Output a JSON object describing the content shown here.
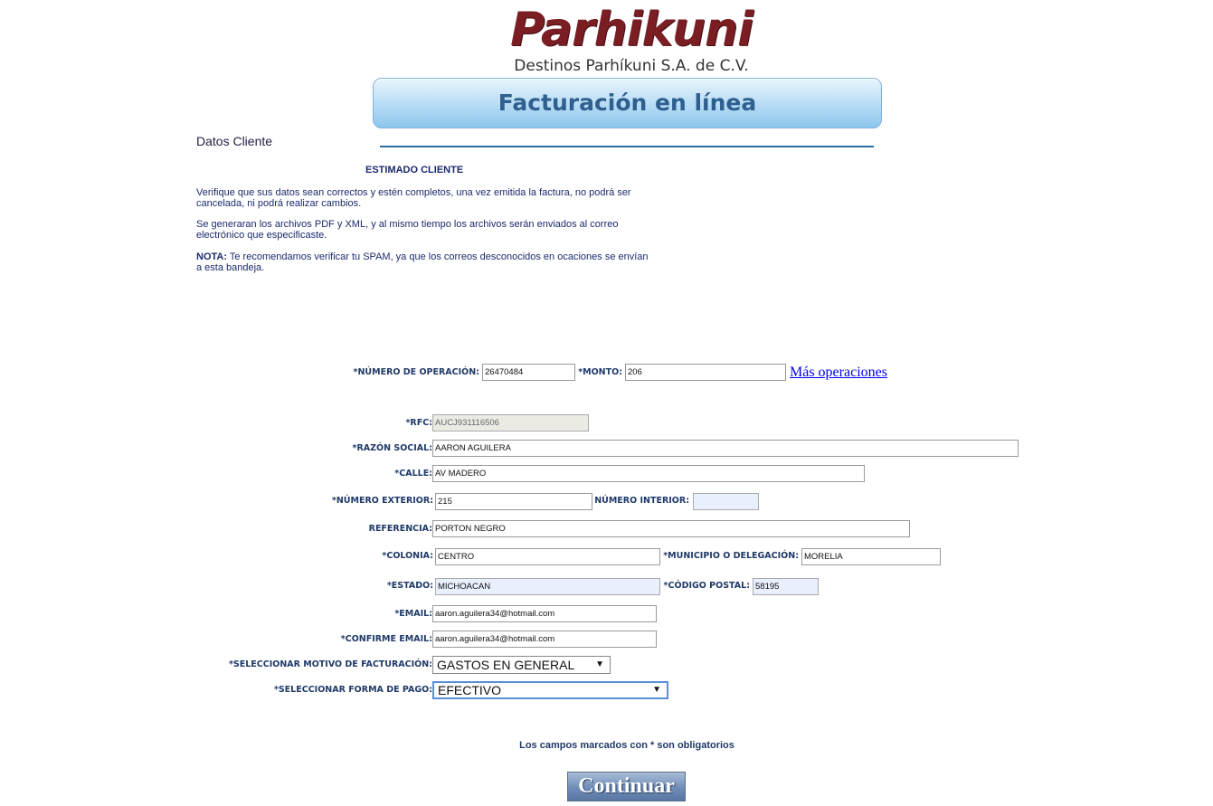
{
  "logo": {
    "name": "Parhikuni",
    "subtitle": "Destinos Parhíkuni S.A. de C.V."
  },
  "banner": {
    "title": "Facturación en línea"
  },
  "section_title": "Datos Cliente",
  "notice": {
    "title": "ESTIMADO CLIENTE",
    "p1": "Verifique que sus datos sean correctos y estén completos, una vez emitida la factura, no podrá ser cancelada, ni podrá realizar cambios.",
    "p2": "Se generaran los archivos PDF y XML, y al mismo tiempo los archivos serán enviados al correo electrónico que especificaste.",
    "p3_label": "NOTA:",
    "p3": " Te recomendamos verificar tu SPAM, ya que los correos desconocidos en ocaciones se envían a esta bandeja."
  },
  "operation": {
    "numero_label": "*NÚMERO DE OPERACIÓN:",
    "numero_value": "26470484",
    "monto_label": "*MONTO:",
    "monto_value": "206",
    "mas_link": "Más operaciones"
  },
  "form": {
    "rfc_label": "*RFC:",
    "rfc_value": "AUCJ931116506",
    "razon_label": "*RAZÓN SOCIAL:",
    "razon_value": "AARON AGUILERA",
    "calle_label": "*CALLE:",
    "calle_value": "AV MADERO",
    "num_ext_label": "*NÚMERO EXTERIOR:",
    "num_ext_value": "215",
    "num_int_label": "NÚMERO INTERIOR:",
    "num_int_value": "",
    "referencia_label": "REFERENCIA:",
    "referencia_value": "PORTON NEGRO",
    "colonia_label": "*COLONIA:",
    "colonia_value": "CENTRO",
    "municipio_label": "*MUNICIPIO O DELEGACIÓN:",
    "municipio_value": "MORELIA",
    "estado_label": "*ESTADO:",
    "estado_value": "MICHOACAN",
    "cp_label": "*CÓDIGO POSTAL:",
    "cp_value": "58195",
    "email_label": "*EMAIL:",
    "email_value": "aaron.aguilera34@hotmail.com",
    "confirm_email_label": "*CONFIRME EMAIL:",
    "confirm_email_value": "aaron.aguilera34@hotmail.com",
    "motivo_label": "*SELECCIONAR MOTIVO DE FACTURACIÓN:",
    "motivo_value": "GASTOS EN GENERAL",
    "forma_pago_label": "*SELECCIONAR FORMA DE PAGO:",
    "forma_pago_value": "EFECTIVO"
  },
  "required_note": "Los campos marcados con * son obligatorios",
  "continue_button": "Continuar",
  "colors": {
    "brand": "#7a1e24",
    "banner_text": "#2e5f8e",
    "label_text": "#1f3a68",
    "button": "#6f8db8"
  }
}
